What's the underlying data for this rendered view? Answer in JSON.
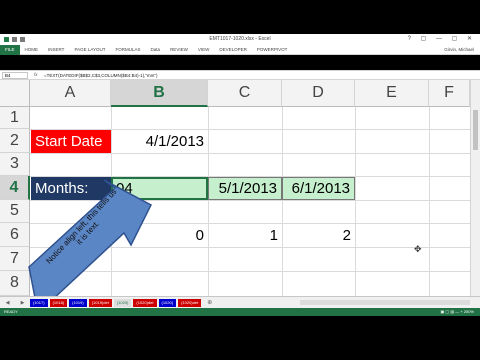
{
  "window": {
    "title": "EMT1017-1020.xlsx - Excel",
    "controls": "? ▢ — ▢ ✕"
  },
  "ribbon": {
    "tabs": [
      "FILE",
      "HOME",
      "INSERT",
      "PAGE LAYOUT",
      "FORMULAS",
      "Data",
      "REVIEW",
      "VIEW",
      "DEVELOPER",
      "POWERPIVOT"
    ],
    "user": "Girvin, Michael"
  },
  "formula_bar": {
    "name_box": "B4",
    "fx": "fx",
    "formula": "=TEXT(DATEDIF($B$2,C$3,COLUMN($B4:B4)-1),\"mm\")"
  },
  "columns": [
    "A",
    "B",
    "C",
    "D",
    "E",
    "F"
  ],
  "rows": [
    "1",
    "2",
    "3",
    "4",
    "5",
    "6",
    "7",
    "8"
  ],
  "cells": {
    "A2": "Start Date",
    "B2": "4/1/2013",
    "A4": "Months:",
    "B4": "04",
    "C4": "5/1/2013",
    "D4": "6/1/2013",
    "B6": "0",
    "C6": "1",
    "D6": "2"
  },
  "callout": {
    "text": "Notice align left, this tells us it is text."
  },
  "sheet_tabs": [
    "(1017)",
    "(1018)",
    "(1019)",
    "(1019)det",
    "(1020)",
    "(1020)det",
    "(1020)",
    "(1020)det"
  ],
  "sheet_tab_colors": [
    "#0000cc",
    "#cc0000",
    "#0000cc",
    "#cc0000",
    "#dddddd",
    "#cc0000",
    "#0000cc",
    "#cc0000"
  ],
  "status": {
    "ready": "READY",
    "zoom": "▣ ▢ ▤ — + 250%"
  },
  "colors": {
    "excel_green": "#217346",
    "start_date_fill": "#ff0000",
    "months_fill": "#1f3864",
    "date_fill": "#c6efce",
    "arrow_fill": "#5b86c5"
  }
}
